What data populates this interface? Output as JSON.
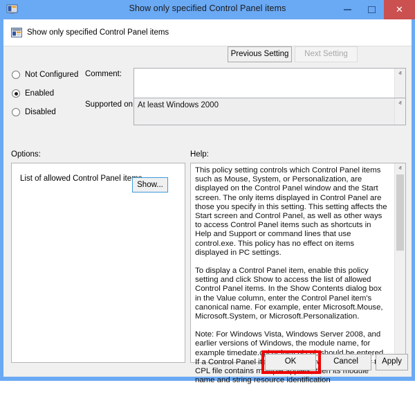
{
  "window": {
    "title": "Show only specified Control Panel items",
    "icon": "control-panel-icon",
    "controls": {
      "minimize": "–",
      "maximize": "□",
      "close": "✕"
    }
  },
  "header": {
    "icon": "policy-setting-icon",
    "title": "Show only specified Control Panel items",
    "previous_setting": "Previous Setting",
    "next_setting": "Next Setting",
    "next_setting_disabled": true
  },
  "state": {
    "options": [
      {
        "label": "Not Configured",
        "selected": false
      },
      {
        "label": "Enabled",
        "selected": true
      },
      {
        "label": "Disabled",
        "selected": false
      }
    ]
  },
  "comment": {
    "label": "Comment:",
    "value": "",
    "placeholder": ""
  },
  "supported_on": {
    "label": "Supported on:",
    "value": "At least Windows 2000"
  },
  "options_panel": {
    "label": "Options:",
    "item_label": "List of allowed Control Panel items",
    "show_button": "Show..."
  },
  "help_panel": {
    "label": "Help:",
    "paragraphs": [
      "This policy setting controls which Control Panel items such as Mouse, System, or Personalization, are displayed on the Control Panel window and the Start screen. The only items displayed in Control Panel are those you specify in this setting. This setting affects the Start screen and Control Panel, as well as other ways to access Control Panel items such as shortcuts in Help and Support or command lines that use control.exe. This policy has no effect on items displayed in PC settings.",
      "To display a Control Panel item, enable this policy setting and click Show to access the list of allowed Control Panel items. In the Show Contents dialog box in the Value column, enter the Control Panel item's canonical name. For example, enter Microsoft.Mouse, Microsoft.System, or Microsoft.Personalization.",
      "Note: For Windows Vista, Windows Server 2008, and earlier versions of Windows, the module name, for example timedate.cpl or inetcpl.cpl, should be entered. If a Control Panel item does not have a CPL file, or the CPL file contains multiple applets, then its module name and string resource identification"
    ]
  },
  "footer": {
    "ok": "OK",
    "cancel": "Cancel",
    "apply": "Apply"
  },
  "annotation": {
    "type": "highlight-rectangle",
    "target": "ok-button",
    "color": "#ee0000"
  },
  "scrollbars": {
    "arrow_up": "ⱏ",
    "arrow_down": "ⱟ"
  }
}
